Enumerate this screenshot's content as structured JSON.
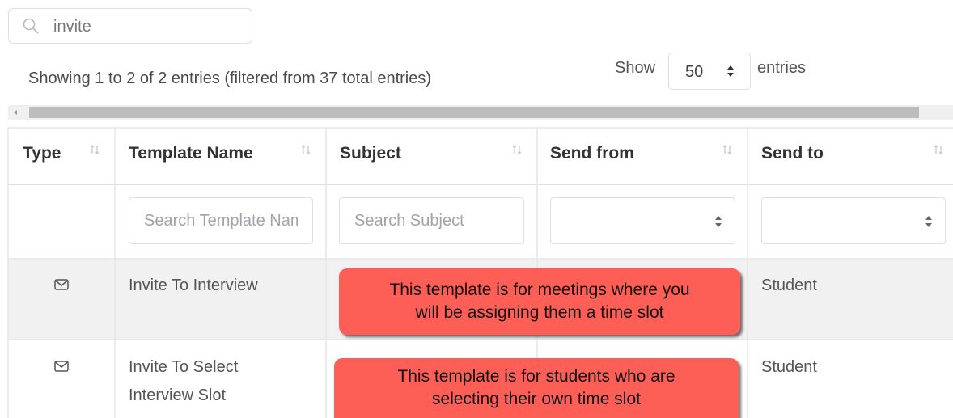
{
  "search": {
    "value": "invite",
    "icon": "search-icon"
  },
  "info": "Showing 1 to 2 of 2 entries (filtered from 37 total entries)",
  "length": {
    "show_label": "Show",
    "value": "50",
    "entries_label": "entries"
  },
  "columns": [
    {
      "label": "Type"
    },
    {
      "label": "Template Name"
    },
    {
      "label": "Subject"
    },
    {
      "label": "Send from"
    },
    {
      "label": "Send to"
    }
  ],
  "filters": {
    "template_name_placeholder": "Search Template Name",
    "subject_placeholder": "Search Subject"
  },
  "rows": [
    {
      "type_icon": "envelope-icon",
      "template_name": "Invite To Interview",
      "send_to": "Student"
    },
    {
      "type_icon": "envelope-icon",
      "template_name_line1": "Invite To Select",
      "template_name_line2": "Interview Slot",
      "send_to": "Student"
    }
  ],
  "callouts": [
    {
      "line1": "This template is for meetings where you",
      "line2": "will be assigning them a time slot"
    },
    {
      "line1": "This template is for students who are",
      "line2": "selecting their own time slot"
    }
  ],
  "colors": {
    "callout": "#fd5f57",
    "row_highlight": "#f1f1f1",
    "border": "#dcdfe3"
  }
}
